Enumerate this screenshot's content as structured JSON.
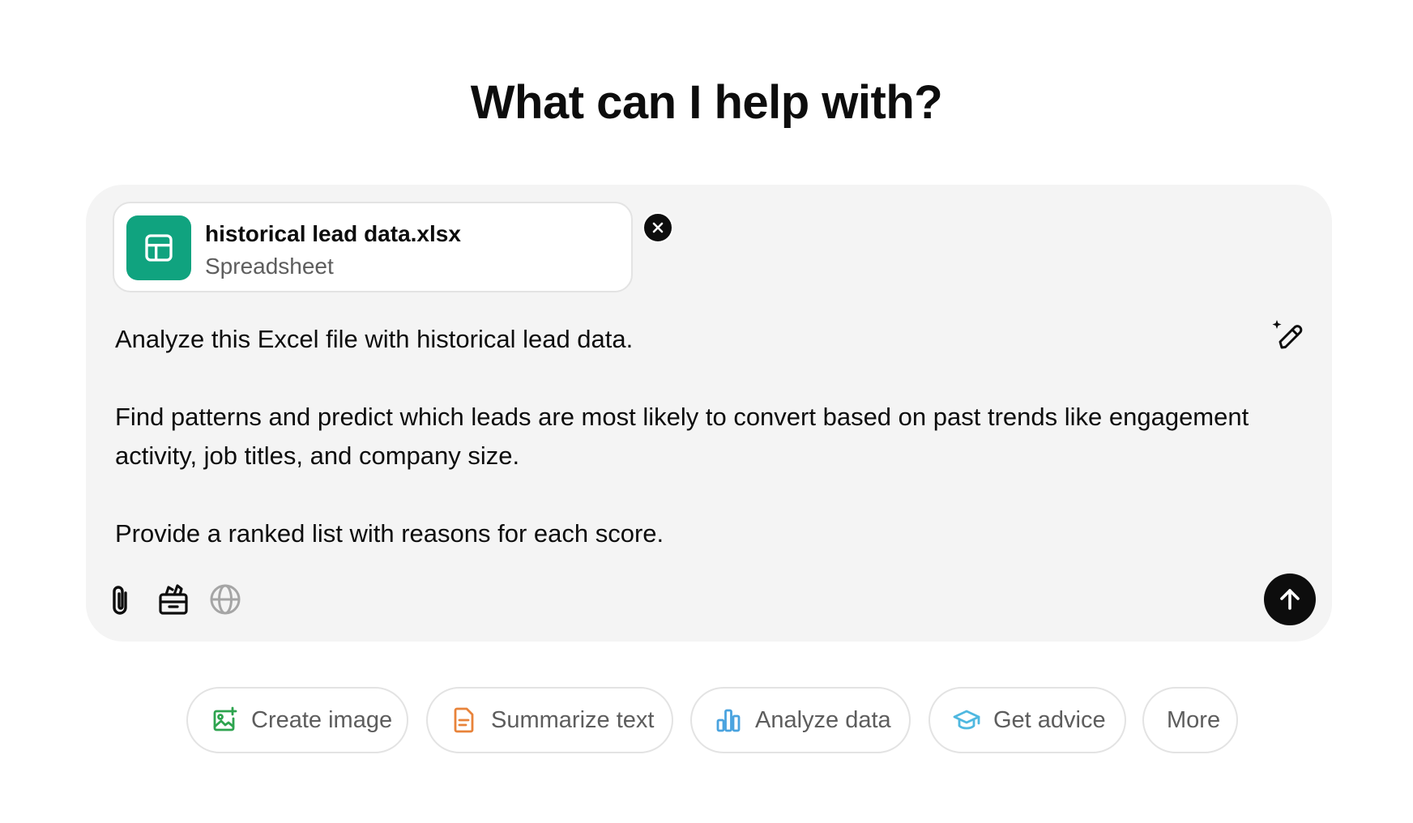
{
  "heading": "What can I help with?",
  "attachment": {
    "file_name": "historical lead data.xlsx",
    "file_type": "Spreadsheet",
    "icon": "spreadsheet-icon",
    "icon_color": "#10a37f"
  },
  "prompt": {
    "paragraphs": [
      "Analyze this Excel file with historical lead data.",
      "Find patterns and predict which leads are most likely to convert based on past trends like engagement activity, job titles, and company size.",
      "Provide a ranked list with reasons for each score."
    ]
  },
  "composer_tools": [
    {
      "name": "attach-icon"
    },
    {
      "name": "toolbox-icon"
    },
    {
      "name": "globe-icon"
    }
  ],
  "suggestions": [
    {
      "label": "Create image",
      "icon": "image-icon",
      "color": "#2ea44f"
    },
    {
      "label": "Summarize text",
      "icon": "document-icon",
      "color": "#e8833a"
    },
    {
      "label": "Analyze data",
      "icon": "bar-chart-icon",
      "color": "#4aa3df"
    },
    {
      "label": "Get advice",
      "icon": "graduation-cap-icon",
      "color": "#4fb8e0"
    },
    {
      "label": "More",
      "icon": "",
      "color": ""
    }
  ],
  "colors": {
    "composer_bg": "#f4f4f4",
    "send_button": "#0d0d0d",
    "muted_text": "#5d5d5d"
  }
}
